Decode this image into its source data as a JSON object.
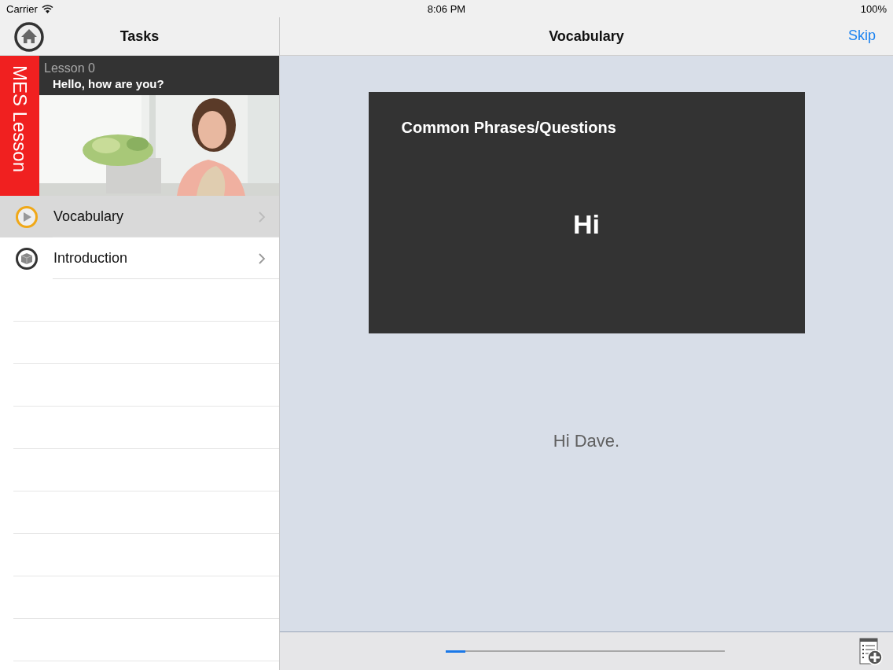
{
  "status_bar": {
    "carrier": "Carrier",
    "time": "8:06 PM",
    "battery": "100%"
  },
  "sidebar": {
    "title": "Tasks",
    "badge": "MES Lesson",
    "lesson": "Lesson 0",
    "lesson_title": "Hello, how are you?",
    "items": [
      {
        "label": "Vocabulary",
        "kind": "play",
        "selected": true
      },
      {
        "label": "Introduction",
        "kind": "box",
        "selected": false
      }
    ]
  },
  "main": {
    "title": "Vocabulary",
    "action": "Skip",
    "card": {
      "category": "Common Phrases/Questions",
      "word": "Hi"
    },
    "sentence": "Hi Dave.",
    "progress": {
      "level": 0.07
    }
  }
}
